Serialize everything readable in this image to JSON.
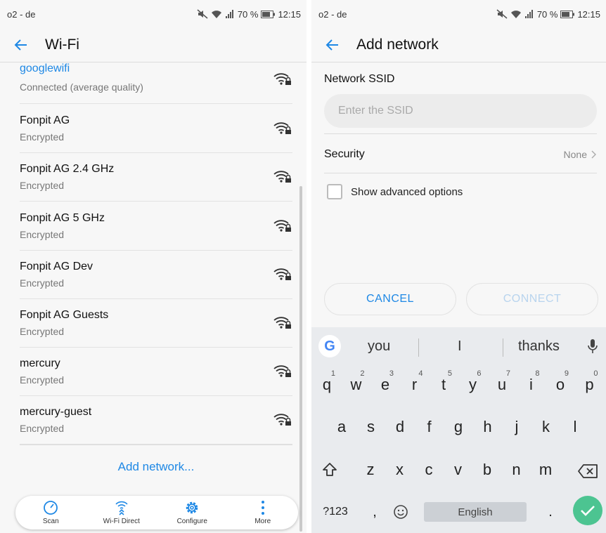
{
  "left": {
    "status": {
      "carrier": "o2 - de",
      "battery": "70 %",
      "time": "12:15"
    },
    "title": "Wi-Fi",
    "networks": [
      {
        "name": "googlewifi",
        "status": "Connected (average quality)"
      },
      {
        "name": "Fonpit AG",
        "status": "Encrypted"
      },
      {
        "name": "Fonpit AG 2.4 GHz",
        "status": "Encrypted"
      },
      {
        "name": "Fonpit AG 5 GHz",
        "status": "Encrypted"
      },
      {
        "name": "Fonpit AG Dev",
        "status": "Encrypted"
      },
      {
        "name": "Fonpit AG Guests",
        "status": "Encrypted"
      },
      {
        "name": "mercury",
        "status": "Encrypted"
      },
      {
        "name": "mercury-guest",
        "status": "Encrypted"
      }
    ],
    "add_network": "Add network...",
    "bottom_bar": [
      {
        "label": "Scan",
        "icon": "scan-icon"
      },
      {
        "label": "Wi-Fi Direct",
        "icon": "wifi-direct-icon"
      },
      {
        "label": "Configure",
        "icon": "gear-icon"
      },
      {
        "label": "More",
        "icon": "more-vert-icon"
      }
    ]
  },
  "right": {
    "status": {
      "carrier": "o2 - de",
      "battery": "70 %",
      "time": "12:15"
    },
    "title": "Add network",
    "ssid_label": "Network SSID",
    "ssid_placeholder": "Enter the SSID",
    "security_label": "Security",
    "security_value": "None",
    "advanced_label": "Show advanced options",
    "cancel_label": "CANCEL",
    "connect_label": "CONNECT",
    "keyboard": {
      "suggestions": [
        "you",
        "I",
        "thanks"
      ],
      "row1": [
        "q",
        "w",
        "e",
        "r",
        "t",
        "y",
        "u",
        "i",
        "o",
        "p"
      ],
      "row1_numbers": [
        "1",
        "2",
        "3",
        "4",
        "5",
        "6",
        "7",
        "8",
        "9",
        "0"
      ],
      "row2": [
        "a",
        "s",
        "d",
        "f",
        "g",
        "h",
        "j",
        "k",
        "l"
      ],
      "row3": [
        "z",
        "x",
        "c",
        "v",
        "b",
        "n",
        "m"
      ],
      "symbols_key": "?123",
      "comma": ",",
      "period": ".",
      "space_label": "English"
    }
  },
  "colors": {
    "accent": "#1e88e5",
    "enter": "#4cc491"
  }
}
